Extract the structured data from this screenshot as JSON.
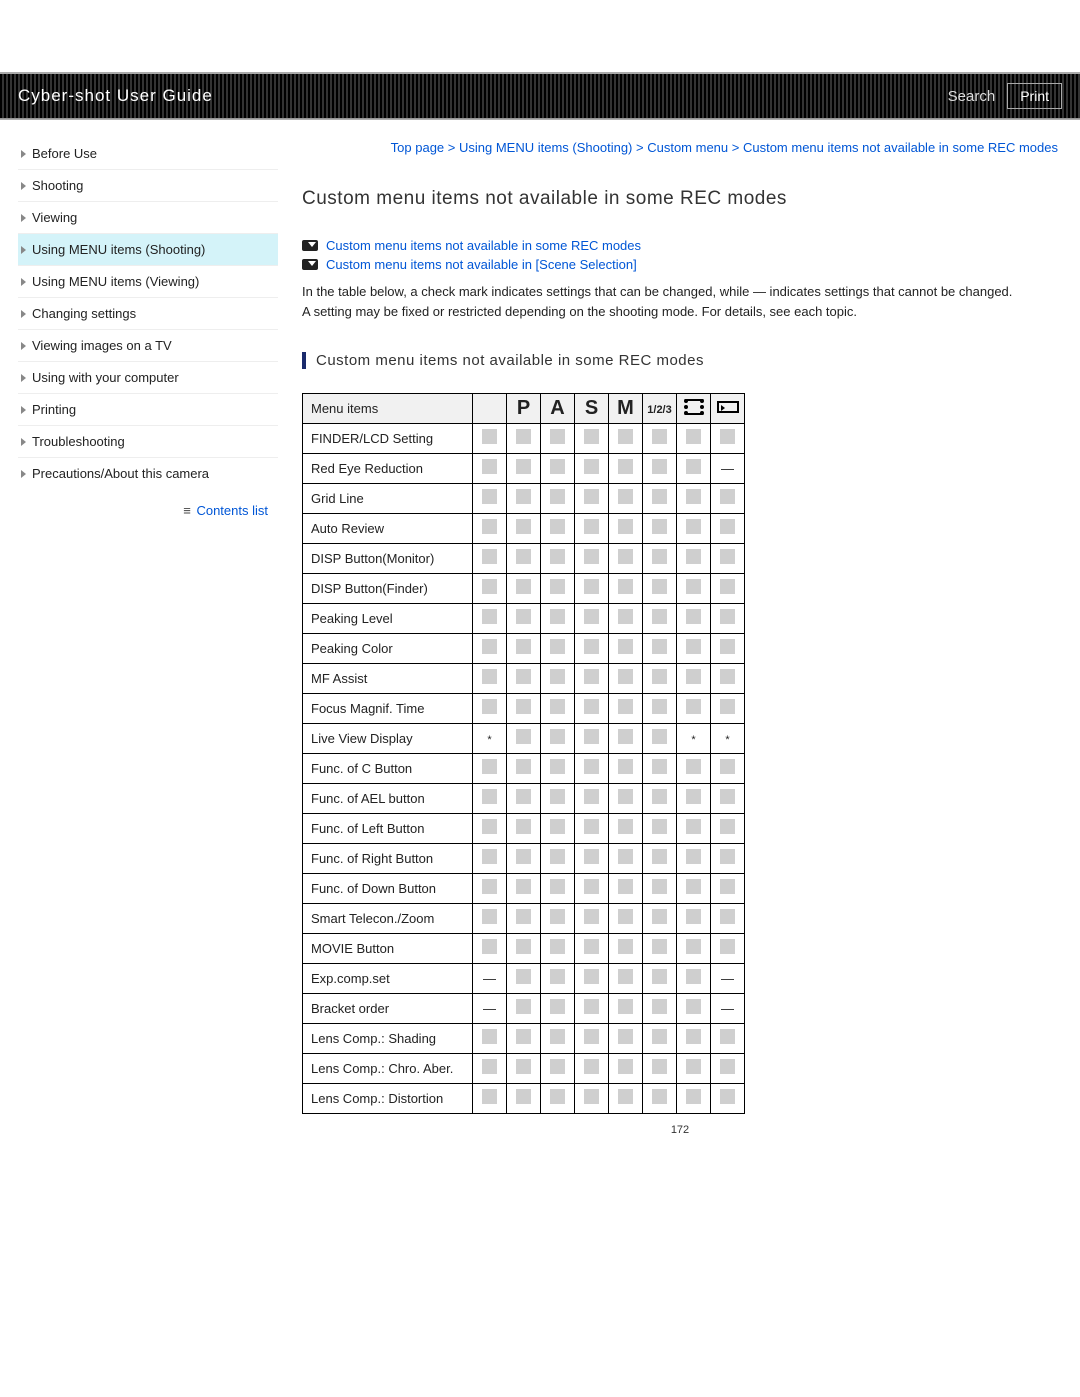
{
  "header": {
    "title": "Cyber-shot User Guide",
    "search": "Search",
    "print": "Print"
  },
  "sidebar": {
    "items": [
      {
        "label": "Before Use"
      },
      {
        "label": "Shooting"
      },
      {
        "label": "Viewing"
      },
      {
        "label": "Using MENU items (Shooting)",
        "active": true
      },
      {
        "label": "Using MENU items (Viewing)"
      },
      {
        "label": "Changing settings"
      },
      {
        "label": "Viewing images on a TV"
      },
      {
        "label": "Using with your computer"
      },
      {
        "label": "Printing"
      },
      {
        "label": "Troubleshooting"
      },
      {
        "label": "Precautions/About this camera"
      }
    ],
    "contents_list": "Contents list"
  },
  "breadcrumb": {
    "parts": [
      "Top page",
      "Using MENU items (Shooting)",
      "Custom menu",
      "Custom menu items not available in some REC modes"
    ],
    "sep": " > "
  },
  "page_title": "Custom menu items not available in some REC modes",
  "jump_links": [
    "Custom menu items not available in some REC modes",
    "Custom menu items not available in [Scene Selection]"
  ],
  "intro": {
    "p1": "In the table below, a check mark indicates settings that can be changed, while — indicates settings that cannot be changed.",
    "p2": "A setting may be fixed or restricted depending on the shooting mode. For details, see each topic."
  },
  "section_heading": "Custom menu items not available in some REC modes",
  "table": {
    "header_label": "Menu items",
    "modes": [
      "auto",
      "P",
      "A",
      "S",
      "M",
      "1/2/3",
      "film",
      "pano"
    ],
    "rows": [
      {
        "label": "FINDER/LCD Setting",
        "cells": [
          "c",
          "c",
          "c",
          "c",
          "c",
          "c",
          "c",
          "c"
        ]
      },
      {
        "label": "Red Eye Reduction",
        "cells": [
          "c",
          "c",
          "c",
          "c",
          "c",
          "c",
          "c",
          "d"
        ]
      },
      {
        "label": "Grid Line",
        "cells": [
          "c",
          "c",
          "c",
          "c",
          "c",
          "c",
          "c",
          "c"
        ]
      },
      {
        "label": "Auto Review",
        "cells": [
          "c",
          "c",
          "c",
          "c",
          "c",
          "c",
          "c",
          "c"
        ]
      },
      {
        "label": "DISP Button(Monitor)",
        "cells": [
          "c",
          "c",
          "c",
          "c",
          "c",
          "c",
          "c",
          "c"
        ]
      },
      {
        "label": "DISP Button(Finder)",
        "cells": [
          "c",
          "c",
          "c",
          "c",
          "c",
          "c",
          "c",
          "c"
        ]
      },
      {
        "label": "Peaking Level",
        "cells": [
          "c",
          "c",
          "c",
          "c",
          "c",
          "c",
          "c",
          "c"
        ]
      },
      {
        "label": "Peaking Color",
        "cells": [
          "c",
          "c",
          "c",
          "c",
          "c",
          "c",
          "c",
          "c"
        ]
      },
      {
        "label": "MF Assist",
        "cells": [
          "c",
          "c",
          "c",
          "c",
          "c",
          "c",
          "c",
          "c"
        ]
      },
      {
        "label": "Focus Magnif. Time",
        "cells": [
          "c",
          "c",
          "c",
          "c",
          "c",
          "c",
          "c",
          "c"
        ]
      },
      {
        "label": "Live View Display",
        "cells": [
          "s",
          "c",
          "c",
          "c",
          "c",
          "c",
          "s",
          "s"
        ]
      },
      {
        "label": "Func. of C Button",
        "cells": [
          "c",
          "c",
          "c",
          "c",
          "c",
          "c",
          "c",
          "c"
        ]
      },
      {
        "label": "Func. of AEL button",
        "cells": [
          "c",
          "c",
          "c",
          "c",
          "c",
          "c",
          "c",
          "c"
        ]
      },
      {
        "label": "Func. of Left Button",
        "cells": [
          "c",
          "c",
          "c",
          "c",
          "c",
          "c",
          "c",
          "c"
        ]
      },
      {
        "label": "Func. of Right Button",
        "cells": [
          "c",
          "c",
          "c",
          "c",
          "c",
          "c",
          "c",
          "c"
        ]
      },
      {
        "label": "Func. of Down Button",
        "cells": [
          "c",
          "c",
          "c",
          "c",
          "c",
          "c",
          "c",
          "c"
        ]
      },
      {
        "label": "Smart Telecon./Zoom",
        "cells": [
          "c",
          "c",
          "c",
          "c",
          "c",
          "c",
          "c",
          "c"
        ]
      },
      {
        "label": "MOVIE Button",
        "cells": [
          "c",
          "c",
          "c",
          "c",
          "c",
          "c",
          "c",
          "c"
        ]
      },
      {
        "label": "Exp.comp.set",
        "cells": [
          "d",
          "c",
          "c",
          "c",
          "c",
          "c",
          "c",
          "d"
        ]
      },
      {
        "label": "Bracket order",
        "cells": [
          "d",
          "c",
          "c",
          "c",
          "c",
          "c",
          "c",
          "d"
        ]
      },
      {
        "label": "Lens Comp.: Shading",
        "cells": [
          "c",
          "c",
          "c",
          "c",
          "c",
          "c",
          "c",
          "c"
        ]
      },
      {
        "label": "Lens Comp.: Chro. Aber.",
        "cells": [
          "c",
          "c",
          "c",
          "c",
          "c",
          "c",
          "c",
          "c"
        ]
      },
      {
        "label": "Lens Comp.: Distortion",
        "cells": [
          "c",
          "c",
          "c",
          "c",
          "c",
          "c",
          "c",
          "c"
        ]
      }
    ]
  },
  "page_number": "172"
}
